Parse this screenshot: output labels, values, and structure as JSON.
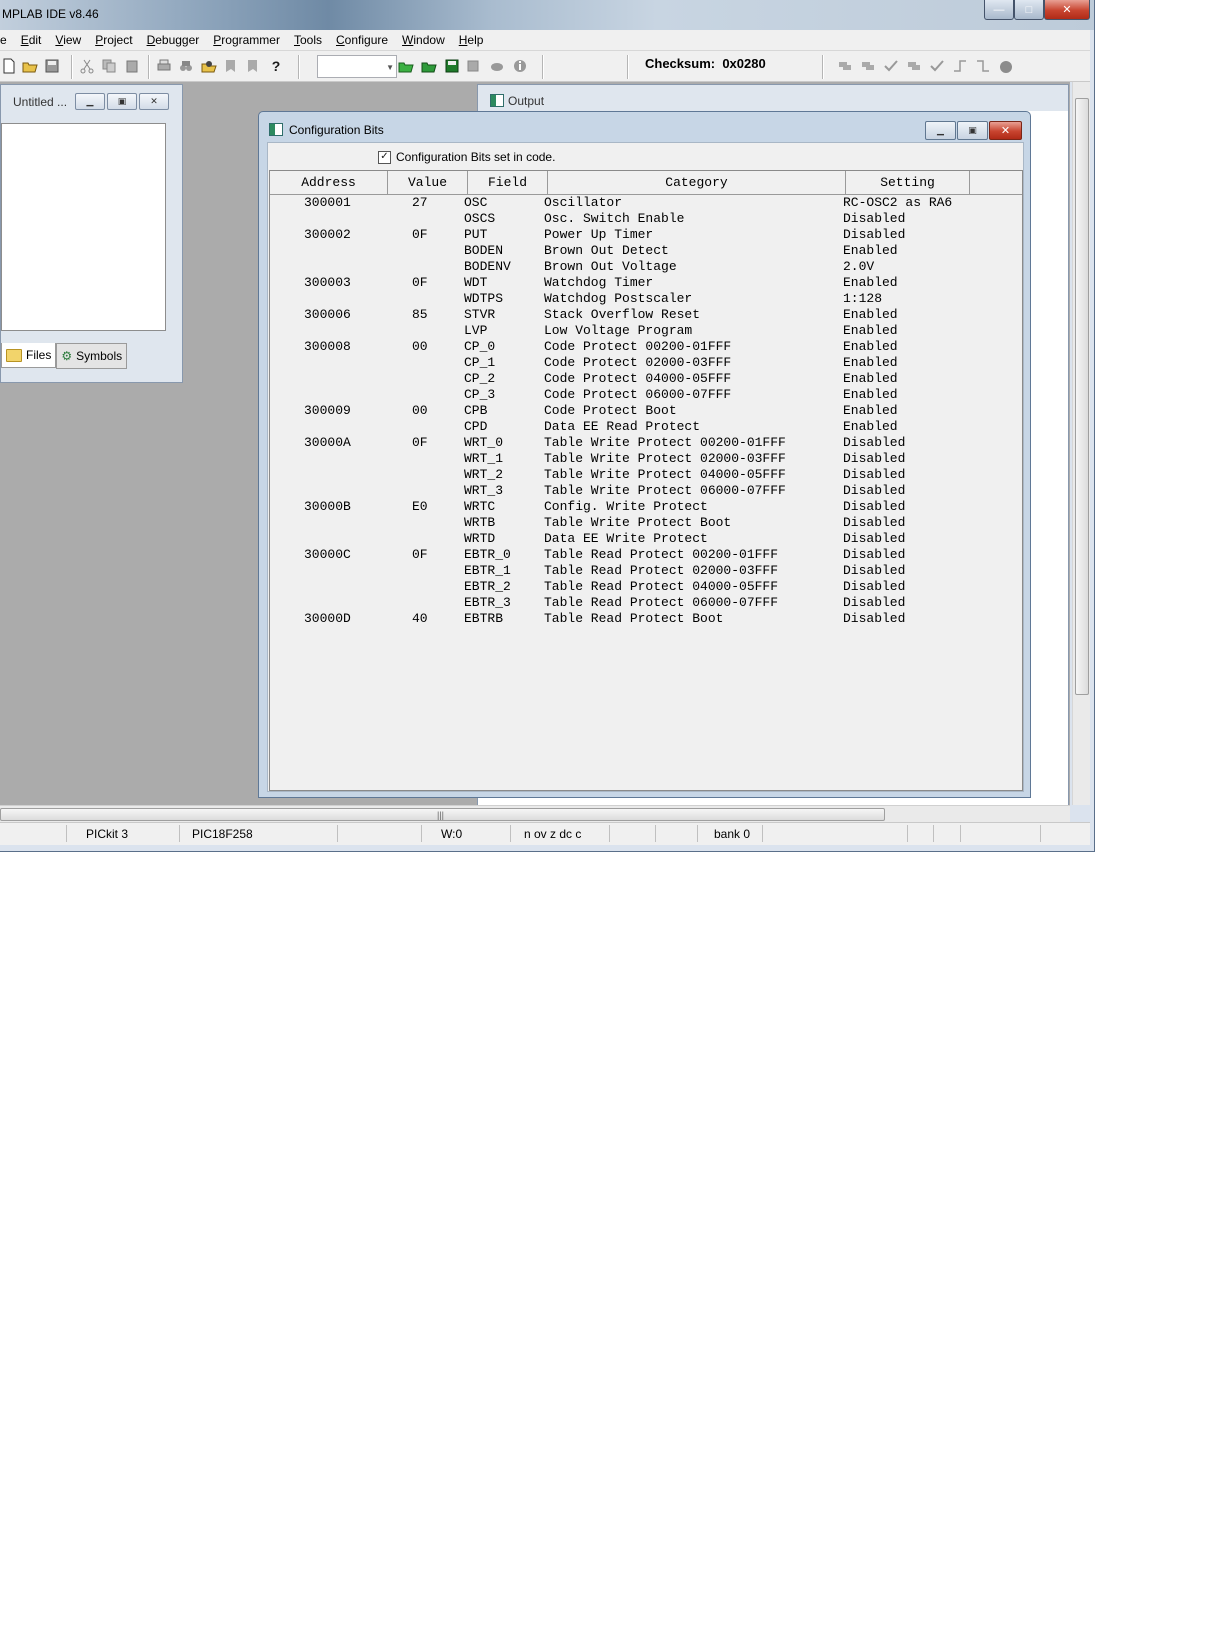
{
  "app": {
    "title": "MPLAB IDE v8.46",
    "window_buttons": {
      "minimize": "—",
      "maximize": "□",
      "close": "✕"
    }
  },
  "menu": [
    {
      "label": "e",
      "underline_first": false
    },
    {
      "label": "Edit",
      "underline_first": true
    },
    {
      "label": "View",
      "underline_first": true
    },
    {
      "label": "Project",
      "underline_first": true
    },
    {
      "label": "Debugger",
      "underline_first": true
    },
    {
      "label": "Programmer",
      "underline_first": true
    },
    {
      "label": "Tools",
      "underline_first": true
    },
    {
      "label": "Configure",
      "underline_first": true
    },
    {
      "label": "Window",
      "underline_first": true
    },
    {
      "label": "Help",
      "underline_first": true
    }
  ],
  "toolbar": {
    "checksum_label": "Checksum:",
    "checksum_value": "0x0280",
    "icons": [
      "new-file-icon",
      "open-folder-icon",
      "save-icon",
      "cut-icon",
      "copy-icon",
      "paste-icon",
      "print-icon",
      "find-icon",
      "find-in-files-icon",
      "bookmark-prev-icon",
      "bookmark-next-icon",
      "help-icon"
    ],
    "icons_right": [
      "new-project-icon",
      "open-project-icon",
      "save-project-icon",
      "build-icon",
      "make-icon",
      "info-icon"
    ],
    "debug_icons": [
      "program-icon",
      "read-icon",
      "verify-icon",
      "erase-icon",
      "blank-check-icon",
      "release-icon",
      "hold-reset-icon",
      "run-icon"
    ]
  },
  "project_window": {
    "title": "Untitled ...",
    "tabs": [
      {
        "label": "Files",
        "icon": "folder-icon",
        "active": true
      },
      {
        "label": "Symbols",
        "icon": "symbols-icon",
        "active": false
      }
    ]
  },
  "output_window": {
    "title": "Output"
  },
  "status_bar": {
    "programmer": "PICkit 3",
    "device": "PIC18F258",
    "w_reg": "W:0",
    "flags": "n ov z dc c",
    "bank": "bank 0"
  },
  "config_dialog": {
    "title": "Configuration Bits",
    "checkbox_label": "Configuration Bits set in code.",
    "checkbox_checked": true,
    "columns": [
      "Address",
      "Value",
      "Field",
      "Category",
      "Setting"
    ],
    "rows": [
      {
        "address": "300001",
        "value": "27",
        "field": "OSC",
        "category": "Oscillator",
        "setting": "RC-OSC2 as RA6"
      },
      {
        "address": "",
        "value": "",
        "field": "OSCS",
        "category": "Osc. Switch Enable",
        "setting": "Disabled"
      },
      {
        "address": "300002",
        "value": "0F",
        "field": "PUT",
        "category": "Power Up Timer",
        "setting": "Disabled"
      },
      {
        "address": "",
        "value": "",
        "field": "BODEN",
        "category": "Brown Out Detect",
        "setting": "Enabled"
      },
      {
        "address": "",
        "value": "",
        "field": "BODENV",
        "category": "Brown Out Voltage",
        "setting": "2.0V"
      },
      {
        "address": "300003",
        "value": "0F",
        "field": "WDT",
        "category": "Watchdog Timer",
        "setting": "Enabled"
      },
      {
        "address": "",
        "value": "",
        "field": "WDTPS",
        "category": "Watchdog Postscaler",
        "setting": "1:128"
      },
      {
        "address": "300006",
        "value": "85",
        "field": "STVR",
        "category": "Stack Overflow Reset",
        "setting": "Enabled"
      },
      {
        "address": "",
        "value": "",
        "field": "LVP",
        "category": "Low Voltage Program",
        "setting": "Enabled"
      },
      {
        "address": "300008",
        "value": "00",
        "field": "CP_0",
        "category": "Code Protect 00200-01FFF",
        "setting": "Enabled"
      },
      {
        "address": "",
        "value": "",
        "field": "CP_1",
        "category": "Code Protect 02000-03FFF",
        "setting": "Enabled"
      },
      {
        "address": "",
        "value": "",
        "field": "CP_2",
        "category": "Code Protect 04000-05FFF",
        "setting": "Enabled"
      },
      {
        "address": "",
        "value": "",
        "field": "CP_3",
        "category": "Code Protect 06000-07FFF",
        "setting": "Enabled"
      },
      {
        "address": "300009",
        "value": "00",
        "field": "CPB",
        "category": "Code Protect Boot",
        "setting": "Enabled"
      },
      {
        "address": "",
        "value": "",
        "field": "CPD",
        "category": "Data EE Read Protect",
        "setting": "Enabled"
      },
      {
        "address": "30000A",
        "value": "0F",
        "field": "WRT_0",
        "category": "Table Write Protect 00200-01FFF",
        "setting": "Disabled"
      },
      {
        "address": "",
        "value": "",
        "field": "WRT_1",
        "category": "Table Write Protect 02000-03FFF",
        "setting": "Disabled"
      },
      {
        "address": "",
        "value": "",
        "field": "WRT_2",
        "category": "Table Write Protect 04000-05FFF",
        "setting": "Disabled"
      },
      {
        "address": "",
        "value": "",
        "field": "WRT_3",
        "category": "Table Write Protect 06000-07FFF",
        "setting": "Disabled"
      },
      {
        "address": "30000B",
        "value": "E0",
        "field": "WRTC",
        "category": "Config. Write Protect",
        "setting": "Disabled"
      },
      {
        "address": "",
        "value": "",
        "field": "WRTB",
        "category": "Table Write Protect Boot",
        "setting": "Disabled"
      },
      {
        "address": "",
        "value": "",
        "field": "WRTD",
        "category": "Data EE Write Protect",
        "setting": "Disabled"
      },
      {
        "address": "30000C",
        "value": "0F",
        "field": "EBTR_0",
        "category": "Table Read Protect 00200-01FFF",
        "setting": "Disabled"
      },
      {
        "address": "",
        "value": "",
        "field": "EBTR_1",
        "category": "Table Read Protect 02000-03FFF",
        "setting": "Disabled"
      },
      {
        "address": "",
        "value": "",
        "field": "EBTR_2",
        "category": "Table Read Protect 04000-05FFF",
        "setting": "Disabled"
      },
      {
        "address": "",
        "value": "",
        "field": "EBTR_3",
        "category": "Table Read Protect 06000-07FFF",
        "setting": "Disabled"
      },
      {
        "address": "30000D",
        "value": "40",
        "field": "EBTRB",
        "category": "Table Read Protect Boot",
        "setting": "Disabled"
      }
    ]
  }
}
